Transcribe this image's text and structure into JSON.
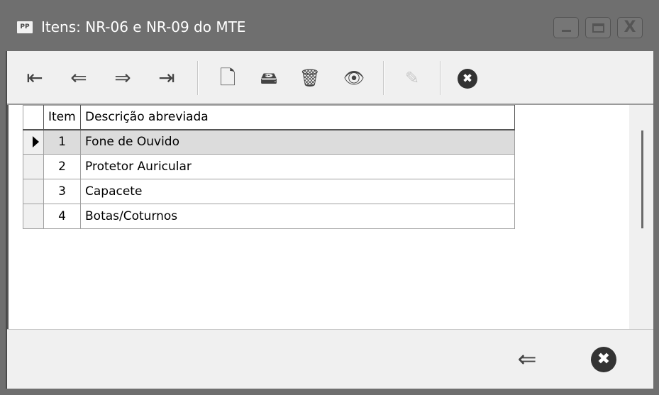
{
  "window": {
    "app_icon_label": "PP",
    "title": "Itens: NR-06 e NR-09 do MTE",
    "minimize_glyph": "_",
    "maximize_glyph": "□",
    "close_glyph": "X"
  },
  "toolbar": {
    "first": "⇤",
    "prev": "⇐",
    "next": "⇒",
    "last": "⇥",
    "new": "🗋",
    "edit": "🖴",
    "delete": "🗑",
    "view": "👁",
    "save": "✎",
    "cancel": "✖"
  },
  "grid": {
    "columns": [
      "Item",
      "Descrição abreviada"
    ],
    "rows": [
      {
        "item": "1",
        "desc": "Fone de Ouvido",
        "selected": true
      },
      {
        "item": "2",
        "desc": "Protetor Auricular",
        "selected": false
      },
      {
        "item": "3",
        "desc": "Capacete",
        "selected": false
      },
      {
        "item": "4",
        "desc": "Botas/Coturnos",
        "selected": false
      }
    ]
  },
  "footer": {
    "back": "⇐",
    "close": "✖"
  }
}
